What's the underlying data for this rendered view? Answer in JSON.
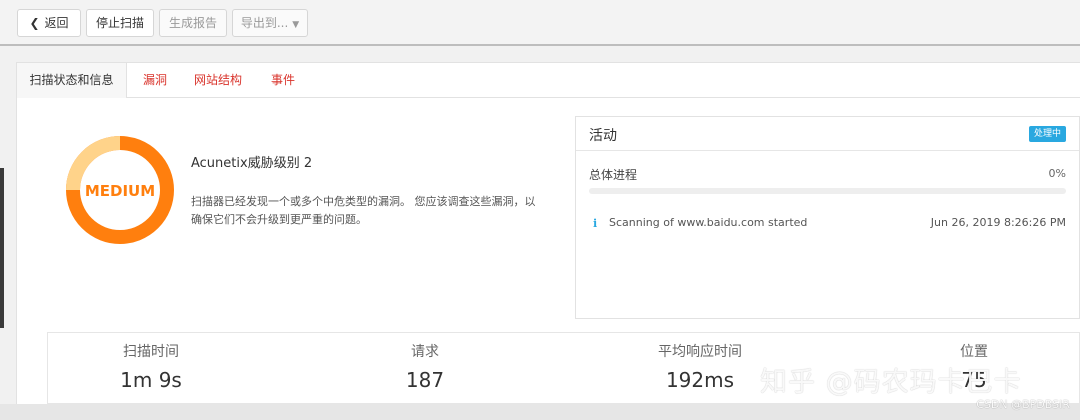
{
  "toolbar": {
    "back_label": "返回",
    "stop_label": "停止扫描",
    "report_label": "生成报告",
    "export_label": "导出到..."
  },
  "tabs": [
    {
      "label": "扫描状态和信息",
      "active": true
    },
    {
      "label": "漏洞",
      "active": false
    },
    {
      "label": "网站结构",
      "active": false
    },
    {
      "label": "事件",
      "active": false
    }
  ],
  "threat": {
    "level_text": "MEDIUM",
    "title": "Acunetix威胁级别 2",
    "description": "扫描器已经发现一个或多个中危类型的漏洞。 您应该调查这些漏洞，以确保它们不会升级到更严重的问题。",
    "colors": {
      "ring_outer": "#ff7f0e",
      "ring_inner": "#ffd38a",
      "text": "#ff7f0e"
    }
  },
  "activity": {
    "title": "活动",
    "status_badge": "处理中",
    "progress_label": "总体进程",
    "progress_text": "0%",
    "progress_value": 0,
    "log": [
      {
        "icon": "info-icon",
        "message": "Scanning of www.baidu.com started",
        "time": "Jun 26, 2019 8:26:26 PM"
      }
    ]
  },
  "stats": [
    {
      "label": "扫描时间",
      "value": "1m 9s"
    },
    {
      "label": "请求",
      "value": "187"
    },
    {
      "label": "平均响应时间",
      "value": "192ms"
    },
    {
      "label": "位置",
      "value": "75"
    }
  ],
  "watermarks": {
    "zhihu": "知乎 @码农玛卡巴卡",
    "csdn": "CSDN @BPDBSIR"
  },
  "accent_color": "#29a8e0",
  "link_color": "#d9332b"
}
